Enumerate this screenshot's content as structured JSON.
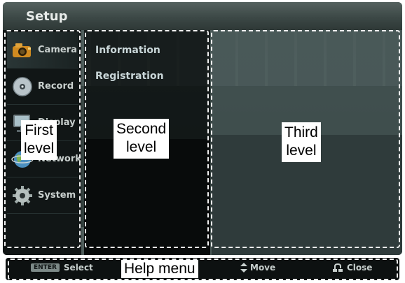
{
  "setup": {
    "title": "Setup"
  },
  "first_level": {
    "items": [
      {
        "label": "Camera",
        "icon": "camera-icon",
        "selected": true
      },
      {
        "label": "Record",
        "icon": "disc-icon",
        "selected": false
      },
      {
        "label": "Display",
        "icon": "monitor-icon",
        "selected": false
      },
      {
        "label": "Network",
        "icon": "globe-icon",
        "selected": false
      },
      {
        "label": "System",
        "icon": "gear-icon",
        "selected": false
      }
    ]
  },
  "second_level": {
    "items": [
      {
        "label": "Information"
      },
      {
        "label": "Registration"
      }
    ]
  },
  "callouts": {
    "first": [
      "First",
      "level"
    ],
    "second": [
      "Second",
      "level"
    ],
    "third": [
      "Third",
      "level"
    ],
    "help": "Help menu"
  },
  "help_bar": {
    "enter_key": "ENTER",
    "select": "Select",
    "move": "Move",
    "close": "Close"
  }
}
